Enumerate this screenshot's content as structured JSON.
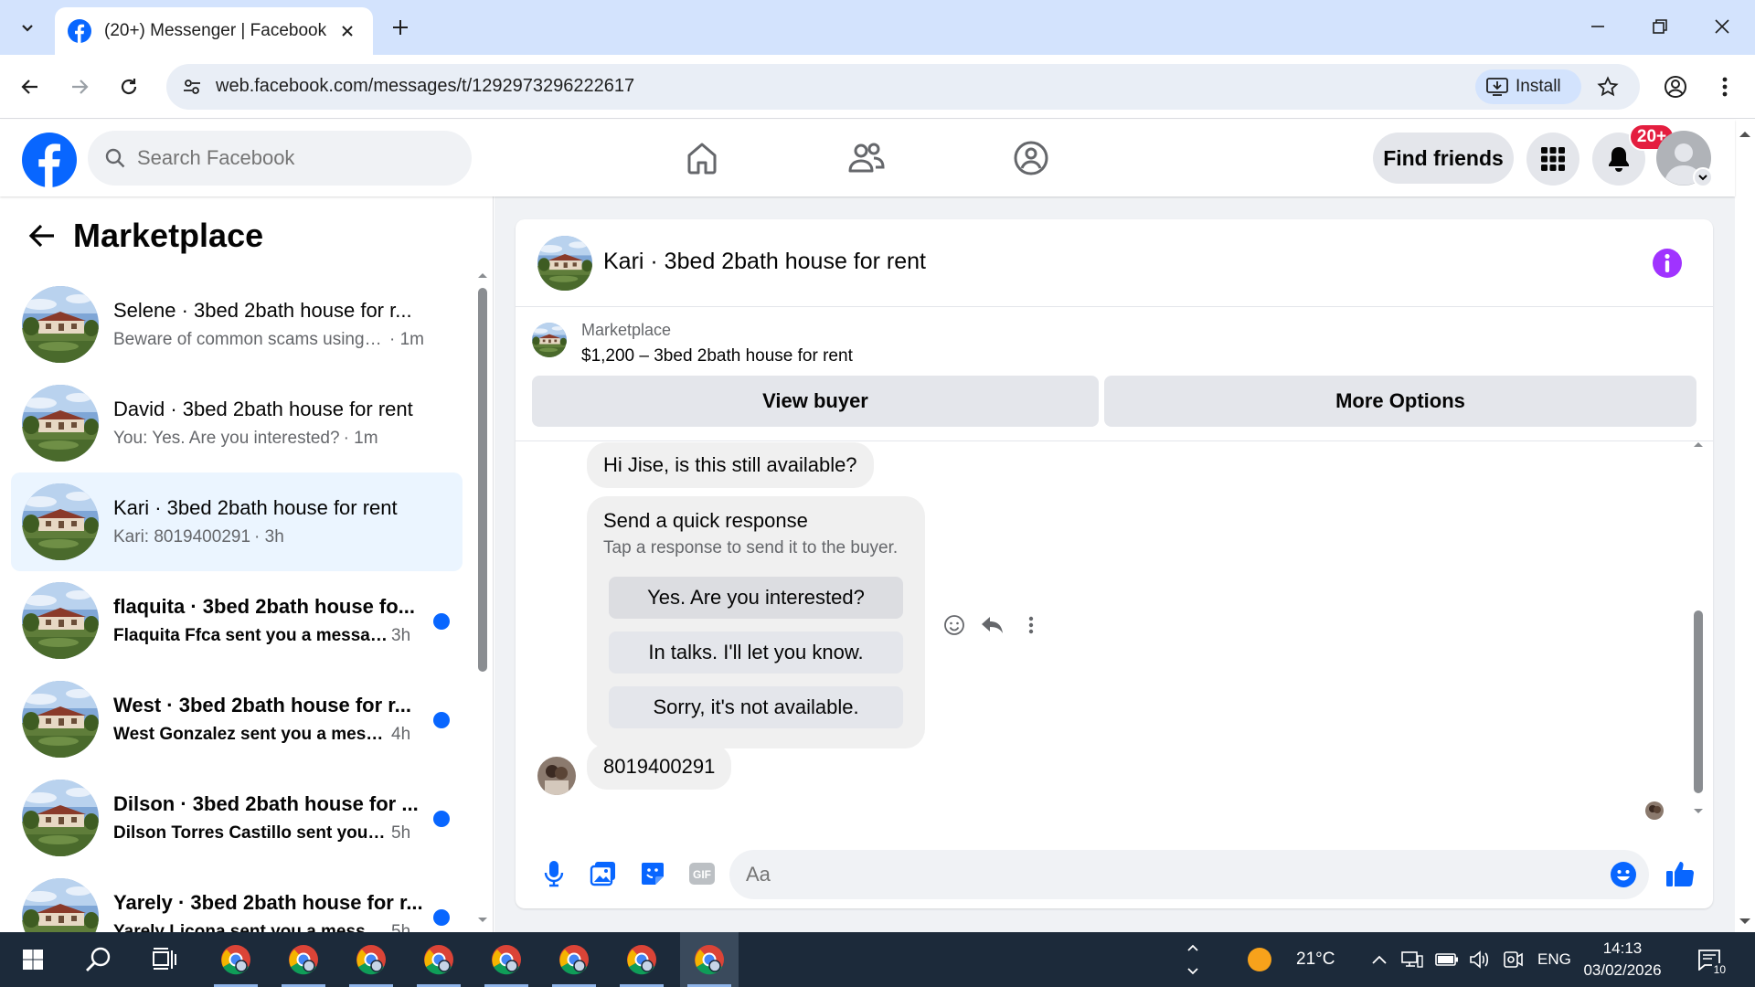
{
  "browser": {
    "tab_title": "(20+) Messenger | Facebook",
    "url": "web.facebook.com/messages/t/1292973296222617",
    "install_label": "Install"
  },
  "fb": {
    "search_placeholder": "Search Facebook",
    "find_friends_label": "Find friends",
    "notification_badge": "20+"
  },
  "sidebar": {
    "title": "Marketplace",
    "conversations": [
      {
        "name": "Selene · 3bed 2bath house for r...",
        "snippet": "Beware of common scams using p...",
        "time": "· 1m",
        "unread": false,
        "active": false
      },
      {
        "name": "David · 3bed 2bath house for rent",
        "snippet": "You: Yes. Are you interested?",
        "time": "· 1m",
        "unread": false,
        "active": false
      },
      {
        "name": "Kari · 3bed 2bath house for rent",
        "snippet": "Kari: 8019400291",
        "time": "· 3h",
        "unread": false,
        "active": true
      },
      {
        "name": "flaquita · 3bed 2bath house fo...",
        "snippet": "Flaquita Ffca sent you a messag...",
        "time": "3h",
        "unread": true,
        "active": false
      },
      {
        "name": "West · 3bed 2bath house for r...",
        "snippet": "West Gonzalez sent you a mess...",
        "time": "4h",
        "unread": true,
        "active": false
      },
      {
        "name": "Dilson · 3bed 2bath house for ...",
        "snippet": "Dilson Torres Castillo sent you a...",
        "time": "5h",
        "unread": true,
        "active": false
      },
      {
        "name": "Yarely · 3bed 2bath house for r...",
        "snippet": "Yarely Licona sent you a messag...",
        "time": "5h",
        "unread": true,
        "active": false
      }
    ]
  },
  "chat": {
    "title": "Kari · 3bed 2bath house for rent",
    "marketplace_label": "Marketplace",
    "listing": "$1,200 – 3bed 2bath house for rent",
    "view_buyer_label": "View buyer",
    "more_options_label": "More Options",
    "first_message": "Hi Jise, is this still available?",
    "quick_response": {
      "title": "Send a quick response",
      "subtitle": "Tap a response to send it to the buyer.",
      "options": [
        "Yes. Are you interested?",
        "In talks. I'll let you know.",
        "Sorry, it's not available."
      ]
    },
    "reply_message": "8019400291",
    "composer_placeholder": "Aa"
  },
  "taskbar": {
    "temperature": "21°C",
    "language": "ENG",
    "time": "14:13",
    "date": "03/02/2026",
    "notification_count": "10"
  },
  "colors": {
    "fb_blue": "#0866ff",
    "messenger_purple": "#a033ff",
    "badge_red": "#e41e3f",
    "active_conv": "#ebf5ff"
  }
}
